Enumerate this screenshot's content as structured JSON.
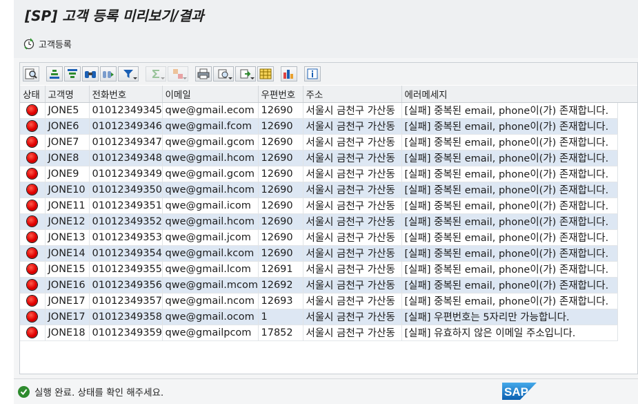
{
  "window": {
    "title": "[SP] 고객 등록 미리보기/결과"
  },
  "app_toolbar": {
    "register_label": "고객등록"
  },
  "grid": {
    "columns": [
      "상태",
      "고객명",
      "전화번호",
      "이메일",
      "우편번호",
      "주소",
      "에러메세지"
    ],
    "rows": [
      {
        "status": "error",
        "name": "JONE5",
        "phone": "01012349345",
        "email": "qwe@gmail.ecom",
        "zip": "12690",
        "address": "서울시 금천구 가산동",
        "message": "[실패] 중복된 email, phone이(가) 존재합니다."
      },
      {
        "status": "error",
        "name": "JONE6",
        "phone": "01012349346",
        "email": "qwe@gmail.fcom",
        "zip": "12690",
        "address": "서울시 금천구 가산동",
        "message": "[실패] 중복된 email, phone이(가) 존재합니다."
      },
      {
        "status": "error",
        "name": "JONE7",
        "phone": "01012349347",
        "email": "qwe@gmail.gcom",
        "zip": "12690",
        "address": "서울시 금천구 가산동",
        "message": "[실패] 중복된 email, phone이(가) 존재합니다."
      },
      {
        "status": "error",
        "name": "JONE8",
        "phone": "01012349348",
        "email": "qwe@gmail.hcom",
        "zip": "12690",
        "address": "서울시 금천구 가산동",
        "message": "[실패] 중복된 email, phone이(가) 존재합니다."
      },
      {
        "status": "error",
        "name": "JONE9",
        "phone": "01012349349",
        "email": "qwe@gmail.gcom",
        "zip": "12690",
        "address": "서울시 금천구 가산동",
        "message": "[실패] 중복된 email, phone이(가) 존재합니다."
      },
      {
        "status": "error",
        "name": "JONE10",
        "phone": "01012349350",
        "email": "qwe@gmail.hcom",
        "zip": "12690",
        "address": "서울시 금천구 가산동",
        "message": "[실패] 중복된 email, phone이(가) 존재합니다."
      },
      {
        "status": "error",
        "name": "JONE11",
        "phone": "01012349351",
        "email": "qwe@gmail.icom",
        "zip": "12690",
        "address": "서울시 금천구 가산동",
        "message": "[실패] 중복된 email, phone이(가) 존재합니다."
      },
      {
        "status": "error",
        "name": "JONE12",
        "phone": "01012349352",
        "email": "qwe@gmail.hcom",
        "zip": "12690",
        "address": "서울시 금천구 가산동",
        "message": "[실패] 중복된 email, phone이(가) 존재합니다."
      },
      {
        "status": "error",
        "name": "JONE13",
        "phone": "01012349353",
        "email": "qwe@gmail.jcom",
        "zip": "12690",
        "address": "서울시 금천구 가산동",
        "message": "[실패] 중복된 email, phone이(가) 존재합니다."
      },
      {
        "status": "error",
        "name": "JONE14",
        "phone": "01012349354",
        "email": "qwe@gmail.kcom",
        "zip": "12690",
        "address": "서울시 금천구 가산동",
        "message": "[실패] 중복된 email, phone이(가) 존재합니다."
      },
      {
        "status": "error",
        "name": "JONE15",
        "phone": "01012349355",
        "email": "qwe@gmail.lcom",
        "zip": "12691",
        "address": "서울시 금천구 가산동",
        "message": "[실패] 중복된 email, phone이(가) 존재합니다."
      },
      {
        "status": "error",
        "name": "JONE16",
        "phone": "01012349356",
        "email": "qwe@gmail.mcom",
        "zip": "12692",
        "address": "서울시 금천구 가산동",
        "message": "[실패] 중복된 email, phone이(가) 존재합니다."
      },
      {
        "status": "error",
        "name": "JONE17",
        "phone": "01012349357",
        "email": "qwe@gmail.ncom",
        "zip": "12693",
        "address": "서울시 금천구 가산동",
        "message": "[실패] 중복된 email, phone이(가) 존재합니다."
      },
      {
        "status": "error",
        "name": "JONE17",
        "phone": "01012349358",
        "email": "qwe@gmail.ocom",
        "zip": "1",
        "address": "서울시 금천구 가산동",
        "message": "[실패] 우편번호는 5자리만 가능합니다."
      },
      {
        "status": "error",
        "name": "JONE18",
        "phone": "01012349359",
        "email": "qwe@gmailpcom",
        "zip": "17852",
        "address": "서울시 금천구 가산동",
        "message": "[실패] 유효하지 않은 이메일 주소입니다."
      }
    ]
  },
  "status_bar": {
    "message": "실행 완료. 상태를 확인 해주세요."
  },
  "brand": {
    "logo_text": "SAP"
  },
  "colors": {
    "error_light": "#e00000",
    "row_stripe": "#dde7f3",
    "success": "#2e8b2e",
    "sap_blue": "#1a7fd1"
  }
}
